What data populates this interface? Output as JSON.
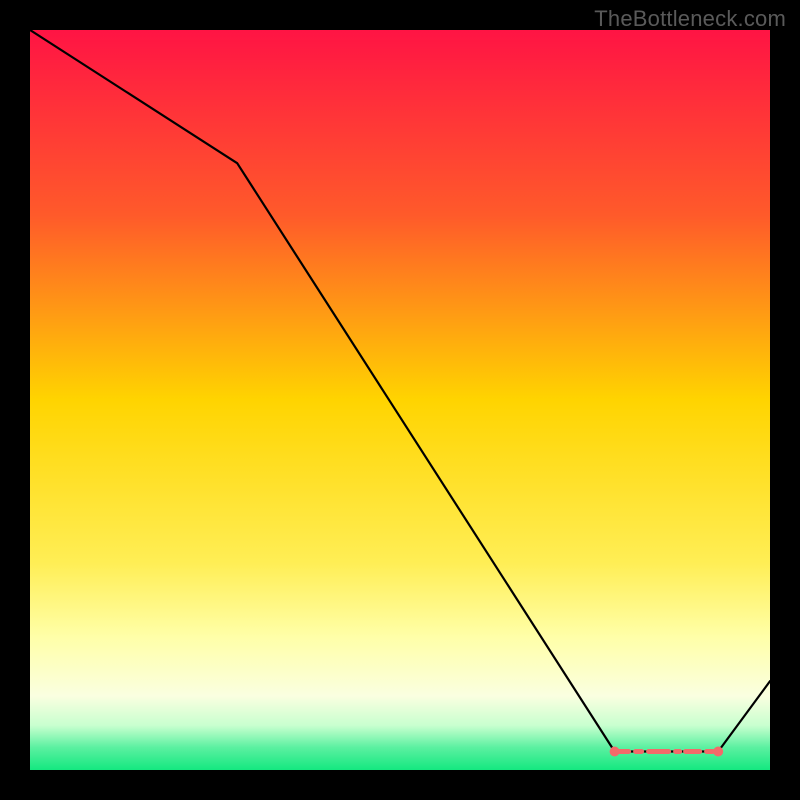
{
  "watermark": "TheBottleneck.com",
  "chart_data": {
    "type": "line",
    "title": "",
    "xlabel": "",
    "ylabel": "",
    "ylim": [
      0,
      100
    ],
    "xlim": [
      0,
      100
    ],
    "x": [
      0,
      28,
      79,
      86,
      93,
      100
    ],
    "values": [
      100,
      82,
      2.5,
      2.5,
      2.5,
      12
    ],
    "gradient_stops": [
      {
        "offset": 0,
        "color": "#ff1444"
      },
      {
        "offset": 0.25,
        "color": "#ff5a2a"
      },
      {
        "offset": 0.5,
        "color": "#ffd400"
      },
      {
        "offset": 0.72,
        "color": "#ffee55"
      },
      {
        "offset": 0.82,
        "color": "#ffffa8"
      },
      {
        "offset": 0.9,
        "color": "#faffe0"
      },
      {
        "offset": 0.94,
        "color": "#c8ffcf"
      },
      {
        "offset": 0.97,
        "color": "#5af0a0"
      },
      {
        "offset": 1.0,
        "color": "#14e880"
      }
    ],
    "marker_segment": {
      "x_start": 79,
      "x_end": 93,
      "y": 2.5,
      "color": "#f46a6a"
    }
  }
}
